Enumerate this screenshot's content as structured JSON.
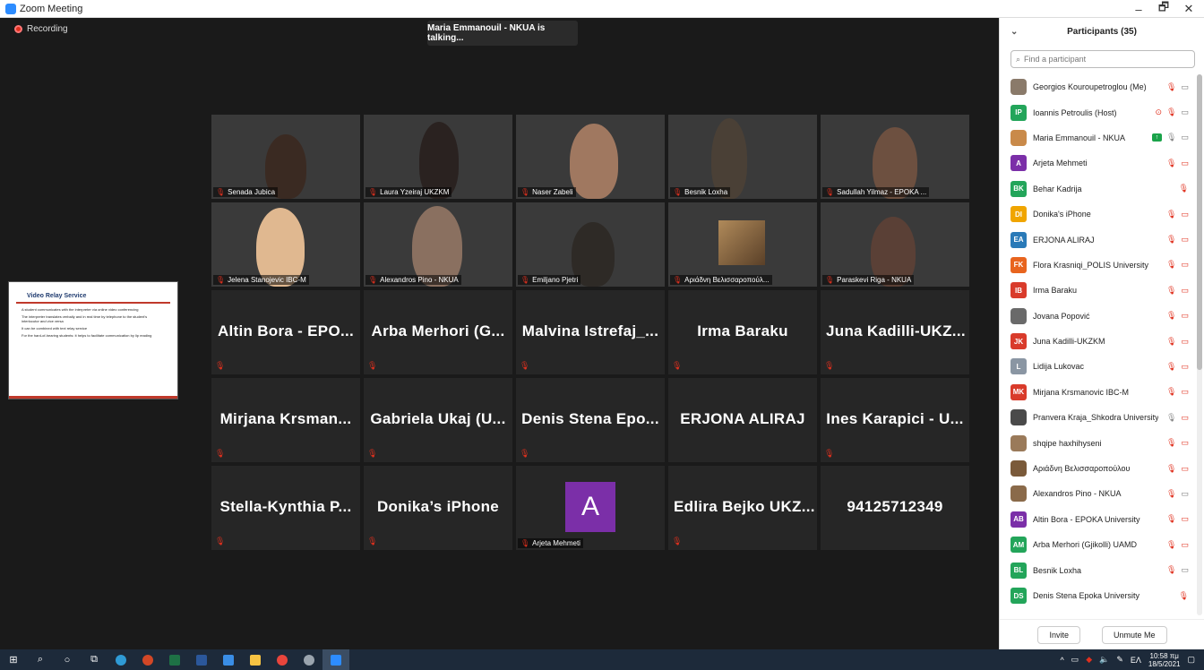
{
  "window": {
    "title": "Zoom Meeting",
    "minimize": "–",
    "restore": "🗗",
    "close": "✕"
  },
  "meeting": {
    "recording_label": "Recording",
    "talking": "Maria Emmanouil - NKUA is talking...",
    "video_tiles": [
      {
        "name": "Senada Jubica",
        "bg": "bg1"
      },
      {
        "name": "Laura Yzeiraj UKZKM",
        "bg": "bg2"
      },
      {
        "name": "Naser Zabeli",
        "bg": "bg3"
      },
      {
        "name": "Besnik Loxha",
        "bg": "bg4"
      },
      {
        "name": "Sadullah Yilmaz - EPOKA ...",
        "bg": "bg5"
      },
      {
        "name": "Jelena Stanojevic IBC-M",
        "bg": "bg6"
      },
      {
        "name": "Alexandros Pino - NKUA",
        "bg": "bg7"
      },
      {
        "name": "Emiljano Pjetri",
        "bg": "bg8"
      },
      {
        "name": "Αριάδνη Βελισσαροπούλ...",
        "bg": "bg9"
      },
      {
        "name": "Paraskevi Riga - NKUA",
        "bg": "bg10"
      }
    ],
    "name_tiles": [
      "Altin Bora - EPO...",
      "Arba Merhori (G...",
      "Malvina Istrefaj_...",
      "Irma Baraku",
      "Juna Kadilli-UKZ...",
      "Mirjana Krsman...",
      "Gabriela Ukaj (U...",
      "Denis Stena Epo...",
      "ERJONA ALIRAJ",
      "Ines Karapici - U...",
      "Stella-Kynthia P...",
      "Donika’s iPhone",
      "",
      "Edlira Bejko UKZ...",
      "94125712349"
    ],
    "avatar_tile": {
      "letter": "A",
      "name": "Arjeta Mehmeti",
      "color": "#7b2fa8"
    },
    "share": {
      "title": "Video Relay Service",
      "bullets": [
        "A student communicates with the interpreter via online video conferencing",
        "The interpreter translates verbally and in real time by telephone to the student's interlocutor and vice versa",
        "It can be combined with text relay service",
        "For the hard-of-hearing students: it helps to facilitate communication by lip reading"
      ]
    }
  },
  "participants": {
    "header": "Participants (35)",
    "search_placeholder": "Find a participant",
    "list": [
      {
        "name": "Georgios Kouroupetroglou (Me)",
        "initials": "",
        "color": "#8a7a6a",
        "photo": true,
        "icons": [
          "mic-off",
          "cam"
        ]
      },
      {
        "name": "Ioannis Petroulis (Host)",
        "initials": "IP",
        "color": "#23a55a",
        "icons": [
          "rec",
          "mic-off",
          "cam"
        ]
      },
      {
        "name": "Maria Emmanouil - NKUA",
        "initials": "",
        "color": "#c98a4a",
        "photo": true,
        "icons": [
          "share",
          "mic",
          "cam"
        ]
      },
      {
        "name": "Arjeta Mehmeti",
        "initials": "A",
        "color": "#7b2fa8",
        "icons": [
          "mic-off",
          "cam-off"
        ]
      },
      {
        "name": "Behar Kadrija",
        "initials": "BK",
        "color": "#23a55a",
        "icons": [
          "mic-off"
        ]
      },
      {
        "name": "Donika's iPhone",
        "initials": "DI",
        "color": "#f0a500",
        "icons": [
          "mic-off",
          "cam-off"
        ]
      },
      {
        "name": "ERJONA ALIRAJ",
        "initials": "EA",
        "color": "#2a7ab8",
        "icons": [
          "mic-off",
          "cam-off"
        ]
      },
      {
        "name": "Flora Krasniqi_POLIS University",
        "initials": "FK",
        "color": "#e8641e",
        "icons": [
          "mic-off",
          "cam-off"
        ]
      },
      {
        "name": "Irma Baraku",
        "initials": "IB",
        "color": "#d93b2b",
        "icons": [
          "mic-off",
          "cam-off"
        ]
      },
      {
        "name": "Jovana Popović",
        "initials": "",
        "color": "#6a6a6a",
        "photo": true,
        "icons": [
          "mic-off",
          "cam-off"
        ]
      },
      {
        "name": "Juna Kadilli-UKZKM",
        "initials": "JK",
        "color": "#d93b2b",
        "icons": [
          "mic-off",
          "cam-off"
        ]
      },
      {
        "name": "Lidija Lukovac",
        "initials": "L",
        "color": "#8a96a3",
        "icons": [
          "mic-off",
          "cam-off"
        ]
      },
      {
        "name": "Mirjana Krsmanovic IBC-M",
        "initials": "MK",
        "color": "#d93b2b",
        "icons": [
          "mic-off",
          "cam-off"
        ]
      },
      {
        "name": "Pranvera Kraja_Shkodra University",
        "initials": "",
        "color": "#4a4a4a",
        "photo": true,
        "icons": [
          "mic",
          "cam-off"
        ]
      },
      {
        "name": "shqipe haxhihyseni",
        "initials": "",
        "color": "#9a7a5a",
        "photo": true,
        "icons": [
          "mic-off",
          "cam-off"
        ]
      },
      {
        "name": "Αριάδνη Βελισσαροπούλου",
        "initials": "",
        "color": "#7a5a3a",
        "photo": true,
        "icons": [
          "mic-off",
          "cam-off"
        ]
      },
      {
        "name": "Alexandros Pino - NKUA",
        "initials": "",
        "color": "#8a6a4a",
        "photo": true,
        "icons": [
          "mic-off",
          "cam"
        ]
      },
      {
        "name": "Altin Bora - EPOKA University",
        "initials": "AB",
        "color": "#7b2fa8",
        "icons": [
          "mic-off",
          "cam-off"
        ]
      },
      {
        "name": "Arba Merhori (Gjikolli) UAMD",
        "initials": "AM",
        "color": "#23a55a",
        "icons": [
          "mic-off",
          "cam-off"
        ]
      },
      {
        "name": "Besnik Loxha",
        "initials": "BL",
        "color": "#23a55a",
        "icons": [
          "mic-off",
          "cam"
        ]
      },
      {
        "name": "Denis Stena Epoka University",
        "initials": "DS",
        "color": "#23a55a",
        "icons": [
          "mic-off"
        ]
      }
    ],
    "invite": "Invite",
    "unmute_me": "Unmute Me"
  },
  "taskbar": {
    "time": "10:58 πμ",
    "date": "18/5/2021",
    "lang": "ΕΛ"
  }
}
